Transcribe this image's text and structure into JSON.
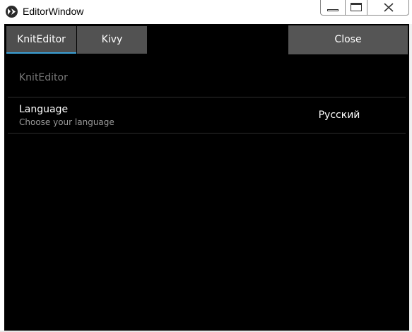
{
  "window": {
    "title": "EditorWindow"
  },
  "icons": {
    "app": "kivy-logo-icon",
    "minimize": "minimize-icon",
    "maximize": "maximize-icon",
    "close": "close-icon"
  },
  "tabs": [
    {
      "label": "KnitEditor",
      "selected": true
    },
    {
      "label": "Kivy",
      "selected": false
    }
  ],
  "close_button": {
    "label": "Close"
  },
  "settings_panel": {
    "section_title": "KnitEditor",
    "items": [
      {
        "title": "Language",
        "description": "Choose your language",
        "value": "Русский"
      }
    ]
  },
  "colors": {
    "background": "#000000",
    "button": "#555555",
    "selected_tab_accent": "#3aa0d6",
    "muted_text": "#7a7a7a"
  }
}
